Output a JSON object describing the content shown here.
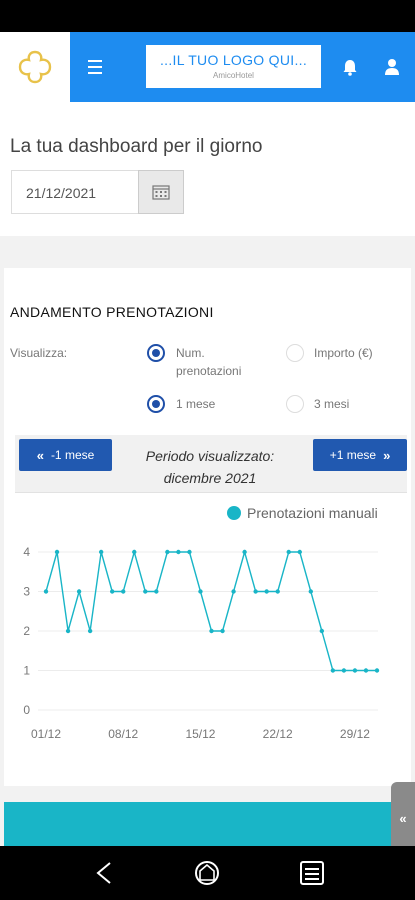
{
  "header": {
    "logo_text": "...IL TUO LOGO QUI...",
    "logo_sub": "AmicoHotel"
  },
  "dashboard": {
    "title": "La tua dashboard per il giorno",
    "date_value": "21/12/2021"
  },
  "bookings": {
    "title": "ANDAMENTO PRENOTAZIONI",
    "visualize_label": "Visualizza:",
    "metric_options": [
      {
        "label": "Num. prenotazioni",
        "selected": true
      },
      {
        "label": "Importo (€)",
        "selected": false
      }
    ],
    "range_options": [
      {
        "label": "1 mese",
        "selected": true
      },
      {
        "label": "3 mesi",
        "selected": false
      }
    ],
    "prev_button": "-1 mese",
    "next_button": "+1 mese",
    "period_label": "Periodo visualizzato:",
    "period_value": "dicembre 2021"
  },
  "chart_data": {
    "type": "line",
    "x": [
      "01/12",
      "02/12",
      "03/12",
      "04/12",
      "05/12",
      "06/12",
      "07/12",
      "08/12",
      "09/12",
      "10/12",
      "11/12",
      "12/12",
      "13/12",
      "14/12",
      "15/12",
      "16/12",
      "17/12",
      "18/12",
      "19/12",
      "20/12",
      "21/12",
      "22/12",
      "23/12",
      "24/12",
      "25/12",
      "26/12",
      "27/12",
      "28/12",
      "29/12",
      "30/12",
      "31/12"
    ],
    "series": [
      {
        "name": "Prenotazioni manuali",
        "color": "#19b5c7",
        "values": [
          3,
          4,
          2,
          3,
          2,
          4,
          3,
          3,
          4,
          3,
          3,
          4,
          4,
          4,
          3,
          2,
          2,
          3,
          4,
          3,
          3,
          3,
          4,
          4,
          3,
          2,
          1,
          1,
          1,
          1,
          1
        ]
      }
    ],
    "xticks": [
      "01/12",
      "08/12",
      "15/12",
      "22/12",
      "29/12"
    ],
    "yticks": [
      0,
      1,
      2,
      3,
      4
    ],
    "ylim": [
      0,
      4
    ],
    "grid": true,
    "legend_position": "top-right"
  }
}
